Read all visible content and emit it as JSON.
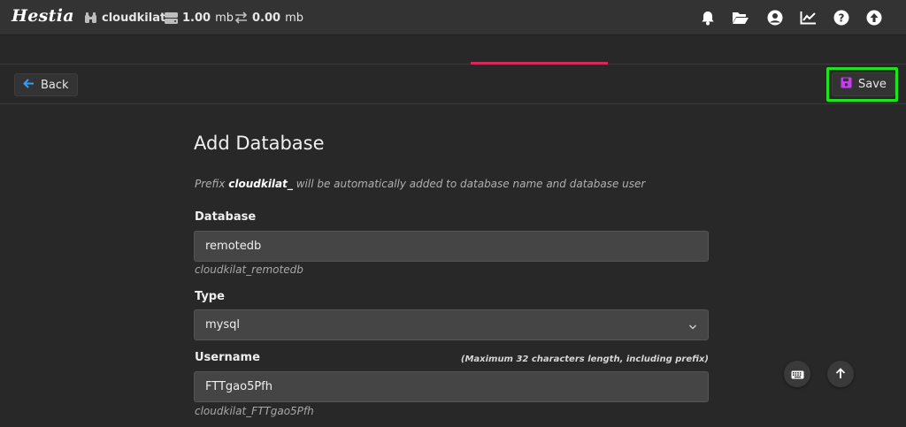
{
  "topbar": {
    "logo_text": "Hestia",
    "user": "cloudkilat",
    "disk_value": "1.00",
    "disk_unit": "mb",
    "bandwidth_value": "0.00",
    "bandwidth_unit": "mb",
    "icons": [
      "bell-icon",
      "folder-open-icon",
      "user-circle-icon",
      "chart-line-icon",
      "question-circle-icon",
      "arrow-circle-up-icon"
    ]
  },
  "toolbar": {
    "back_label": "Back",
    "save_label": "Save",
    "accent_color": "#d5295e",
    "save_icon_color": "#c43ef0",
    "highlight_color": "#1fe31c"
  },
  "form": {
    "title": "Add Database",
    "hint_pre": "Prefix ",
    "hint_prefix": "cloudkilat_",
    "hint_post": " will be automatically added to database name and database user",
    "database": {
      "label": "Database",
      "value": "remotedb",
      "full_name": "cloudkilat_remotedb"
    },
    "type": {
      "label": "Type",
      "value": "mysql"
    },
    "username": {
      "label": "Username",
      "note": "(Maximum 32 characters length, including prefix)",
      "value": "FTTgao5Pfh",
      "full_name": "cloudkilat_FTTgao5Pfh"
    }
  }
}
